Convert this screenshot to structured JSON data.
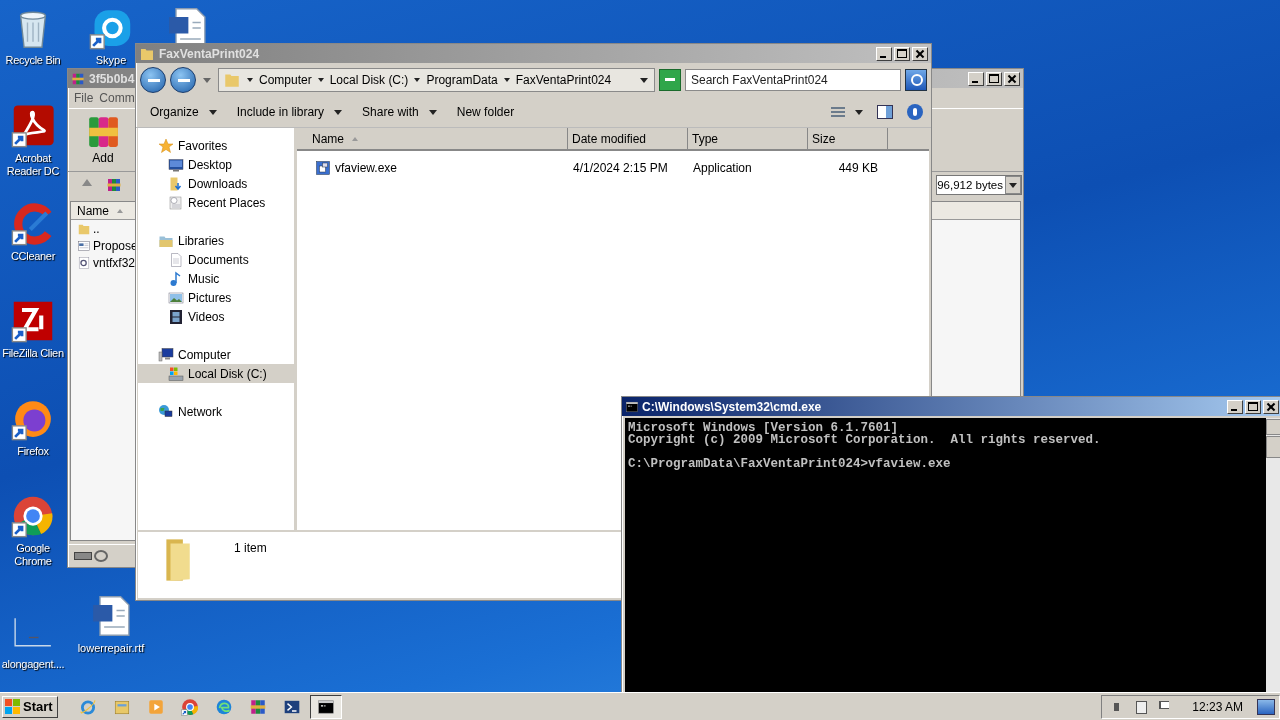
{
  "desktop_icons": [
    {
      "label": "Recycle Bin",
      "kind": "recycle"
    },
    {
      "label": "Acrobat Reader DC",
      "kind": "acrobat"
    },
    {
      "label": "CCleaner",
      "kind": "ccleaner"
    },
    {
      "label": "FileZilla Clien",
      "kind": "filezilla"
    },
    {
      "label": "Firefox",
      "kind": "firefox"
    },
    {
      "label": "Google Chrome",
      "kind": "chrome"
    },
    {
      "label": "alongagent....",
      "kind": "blank"
    },
    {
      "label": "Skype",
      "kind": "skype"
    },
    {
      "label": "lowerrepair.rtf",
      "kind": "word"
    },
    {
      "kind": "word"
    }
  ],
  "winrar_window": {
    "title": "3f5b0b4",
    "menu": [
      "File",
      "Comm"
    ],
    "toolbar": [
      "Add"
    ],
    "size_field": "96,912 bytes",
    "columns": [
      {
        "label": "Name",
        "sorted": true
      }
    ],
    "files": [
      {
        "name": "..",
        "kind": "up"
      },
      {
        "name": "Propose",
        "kind": "doc"
      },
      {
        "name": "vntfxf32",
        "kind": "dll"
      }
    ]
  },
  "explorer": {
    "title": "FaxVentaPrint024",
    "breadcrumb": [
      "Computer",
      "Local Disk (C:)",
      "ProgramData",
      "FaxVentaPrint024"
    ],
    "search": {
      "placeholder": "Search FaxVentaPrint024"
    },
    "commands": [
      {
        "label": "Organize",
        "dropdown": true
      },
      {
        "label": "Include in library",
        "dropdown": true
      },
      {
        "label": "Share with",
        "dropdown": true
      },
      {
        "label": "New folder",
        "dropdown": false
      }
    ],
    "nav": [
      {
        "label": "Favorites",
        "kind": "star",
        "selected": false,
        "children": [
          {
            "label": "Desktop",
            "kind": "desktop",
            "selected": false
          },
          {
            "label": "Downloads",
            "kind": "downloads",
            "selected": false
          },
          {
            "label": "Recent Places",
            "kind": "recent",
            "selected": false
          }
        ]
      },
      {
        "label": "Libraries",
        "kind": "library",
        "selected": false,
        "children": [
          {
            "label": "Documents",
            "kind": "documents",
            "selected": false
          },
          {
            "label": "Music",
            "kind": "music",
            "selected": false
          },
          {
            "label": "Pictures",
            "kind": "pictures",
            "selected": false
          },
          {
            "label": "Videos",
            "kind": "videos",
            "selected": false
          }
        ]
      },
      {
        "label": "Computer",
        "kind": "computer",
        "selected": false,
        "children": [
          {
            "label": "Local Disk (C:)",
            "kind": "disk",
            "selected": true
          }
        ]
      },
      {
        "label": "Network",
        "kind": "network",
        "selected": false
      }
    ],
    "columns": [
      {
        "label": "Name",
        "sorted": true
      },
      {
        "label": "Date modified",
        "sorted": false
      },
      {
        "label": "Type",
        "sorted": false
      },
      {
        "label": "Size",
        "sorted": false
      }
    ],
    "rows": [
      {
        "name": "vfaview.exe",
        "date": "4/1/2024 2:15 PM",
        "type": "Application",
        "size": "449 KB",
        "kind": "exe"
      }
    ],
    "status": "1 item"
  },
  "cmd_window": {
    "title": "C:\\Windows\\System32\\cmd.exe",
    "output": [
      "Microsoft Windows [Version 6.1.7601]",
      "Copyright (c) 2009 Microsoft Corporation.  All rights reserved."
    ],
    "prompt": "C:\\ProgramData\\FaxVentaPrint024>vfaview.exe"
  },
  "taskbar": {
    "start": "Start",
    "apps": [
      {
        "kind": "ie",
        "active": false
      },
      {
        "kind": "explorer",
        "active": false
      },
      {
        "kind": "media",
        "active": false
      },
      {
        "kind": "chrome",
        "active": false
      },
      {
        "kind": "edge",
        "active": false
      },
      {
        "kind": "winrar",
        "active": false
      },
      {
        "kind": "powershell",
        "active": false
      },
      {
        "kind": "cmd",
        "active": true
      }
    ],
    "time": "12:23 AM"
  }
}
